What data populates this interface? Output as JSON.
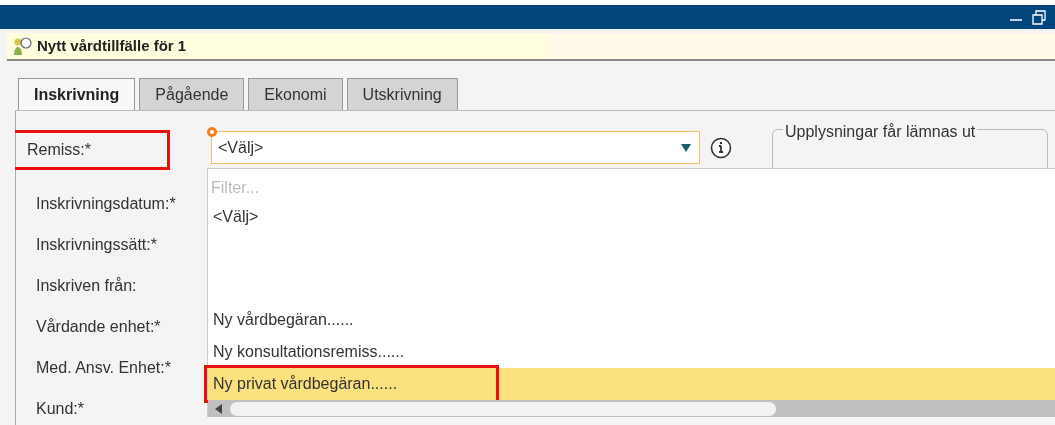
{
  "window": {
    "title": "Nytt vårdtillfälle för 1"
  },
  "tabs": [
    {
      "label": "Inskrivning",
      "selected": true
    },
    {
      "label": "Pågående",
      "selected": false
    },
    {
      "label": "Ekonomi",
      "selected": false
    },
    {
      "label": "Utskrivning",
      "selected": false
    }
  ],
  "form": {
    "fields": [
      {
        "label": "Remiss:*",
        "highlighted": true
      },
      {
        "label": "Inskrivningsdatum:*",
        "highlighted": false
      },
      {
        "label": "Inskrivningssätt:*",
        "highlighted": false
      },
      {
        "label": "Inskriven från:",
        "highlighted": false
      },
      {
        "label": "Vårdande enhet:*",
        "highlighted": false
      },
      {
        "label": "Med. Ansv. Enhet:*",
        "highlighted": false
      },
      {
        "label": "Kund:*",
        "highlighted": false
      }
    ],
    "remiss_select": {
      "value": "<Välj>",
      "expanded": true
    },
    "info_group": {
      "legend": "Upplysningar får lämnas ut"
    }
  },
  "dropdown": {
    "filter": {
      "placeholder": "Filter..."
    },
    "options": [
      {
        "label": "<Välj>",
        "selected": false,
        "highlighted": false
      },
      {
        "label": "Ny vårdbegäran......",
        "selected": false,
        "highlighted": false
      },
      {
        "label": "Ny konsultationsremiss......",
        "selected": false,
        "highlighted": false
      },
      {
        "label": "Ny privat vårdbegäran......",
        "selected": true,
        "highlighted": true
      }
    ]
  }
}
